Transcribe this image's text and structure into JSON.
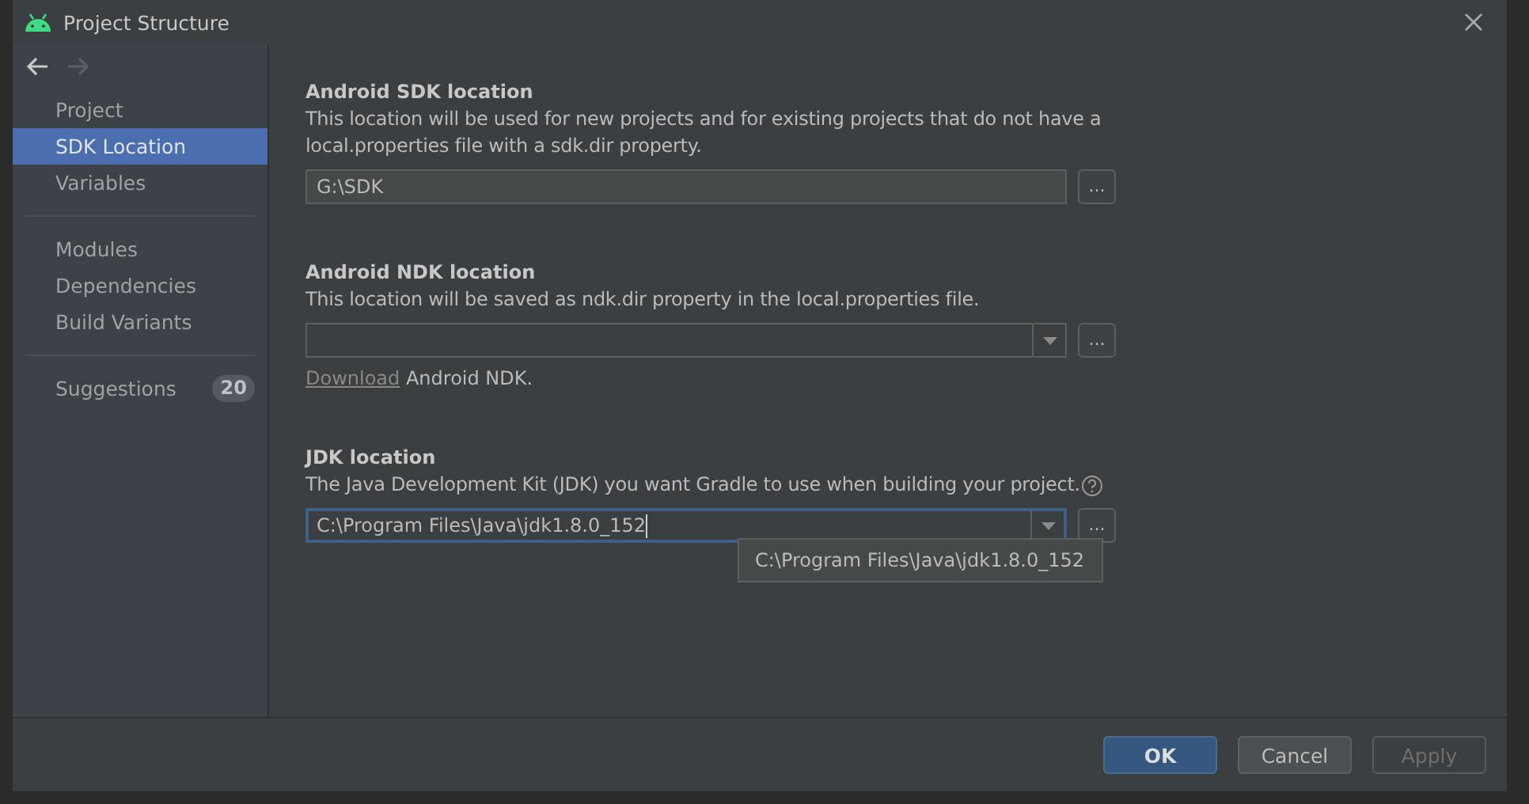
{
  "window": {
    "title": "Project Structure"
  },
  "nav": [
    {
      "kind": "back",
      "disabled": false
    },
    {
      "kind": "forward",
      "disabled": true
    }
  ],
  "sidebar": {
    "groups": [
      [
        {
          "label": "Project",
          "selected": false
        },
        {
          "label": "SDK Location",
          "selected": true
        },
        {
          "label": "Variables",
          "selected": false
        }
      ],
      [
        {
          "label": "Modules",
          "selected": false
        },
        {
          "label": "Dependencies",
          "selected": false
        },
        {
          "label": "Build Variants",
          "selected": false
        }
      ],
      [
        {
          "label": "Suggestions",
          "selected": false,
          "badge": "20"
        }
      ]
    ]
  },
  "sections": [
    {
      "kind": "text",
      "heading": "Android SDK location",
      "description": "This location will be used for new projects and for existing projects that do not have a local.properties file with a sdk.dir property.",
      "value": "G:\\SDK",
      "focused": false,
      "browse": "..."
    },
    {
      "kind": "combo",
      "heading": "Android NDK location",
      "description": "This location will be saved as ndk.dir property in the local.properties file.",
      "focused": false,
      "browse": "...",
      "link": "Download",
      "after_link": " Android NDK."
    },
    {
      "kind": "combo",
      "heading": "JDK location",
      "description": "The Java Development Kit (JDK) you want Gradle to use when building your project.",
      "help": true,
      "value": "C:\\Program Files\\Java\\jdk1.8.0_152",
      "focused": true,
      "browse": "...",
      "popup": "C:\\Program Files\\Java\\jdk1.8.0_152"
    }
  ],
  "buttons": [
    {
      "label": "OK",
      "default": true,
      "disabled": false
    },
    {
      "label": "Cancel",
      "default": false,
      "disabled": false
    },
    {
      "label": "Apply",
      "default": false,
      "disabled": true
    }
  ]
}
